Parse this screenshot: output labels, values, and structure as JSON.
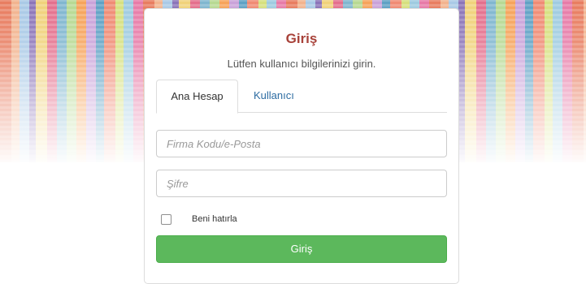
{
  "login": {
    "title": "Giriş",
    "subtitle": "Lütfen kullanıcı bilgilerinizi girin.",
    "tabs": [
      {
        "label": "Ana Hesap",
        "active": true
      },
      {
        "label": "Kullanıcı",
        "active": false
      }
    ],
    "fields": {
      "company_email": {
        "placeholder": "Firma Kodu/e-Posta",
        "value": ""
      },
      "password": {
        "placeholder": "Şifre",
        "value": ""
      }
    },
    "remember_me": {
      "label": "Beni hatırla",
      "checked": false
    },
    "submit_label": "Giriş"
  },
  "colors": {
    "title": "#a8423a",
    "tab_link": "#2d6ca2",
    "submit_bg": "#5cb85c",
    "submit_text": "#ffffff"
  }
}
